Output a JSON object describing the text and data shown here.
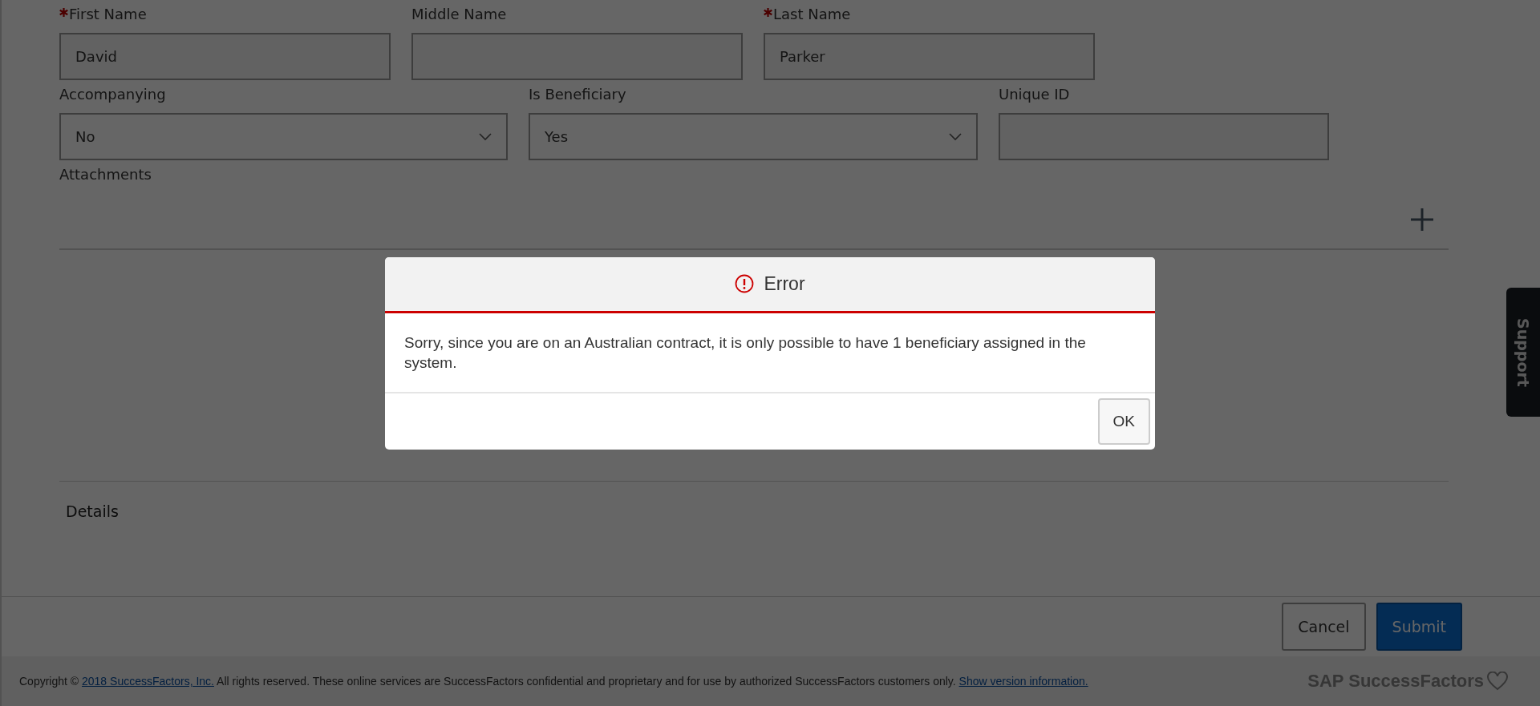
{
  "form": {
    "rows": [
      [
        {
          "label": "First Name",
          "required": true,
          "kind": "text",
          "value": "David"
        },
        {
          "label": "Middle Name",
          "required": false,
          "kind": "text"
        },
        {
          "label": "Last Name",
          "required": true,
          "kind": "text",
          "value": "Parker"
        }
      ],
      [
        {
          "label": "Accompanying",
          "required": false,
          "kind": "select",
          "value": "No"
        },
        {
          "label": "Is Beneficiary",
          "required": false,
          "kind": "select",
          "value": "Yes"
        },
        {
          "label": "Unique ID",
          "required": false,
          "kind": "text"
        }
      ]
    ],
    "attachments_label": "Attachments",
    "details_label": "Details"
  },
  "actions": [
    {
      "label": "Cancel",
      "kind": "secondary"
    },
    {
      "label": "Submit",
      "kind": "primary"
    }
  ],
  "support_tab": "Support",
  "footer": {
    "parts": [
      {
        "kind": "text",
        "text": "Copyright © "
      },
      {
        "kind": "link",
        "text": "2018 SuccessFactors, Inc."
      },
      {
        "kind": "text",
        "text": " All rights reserved. These online services are SuccessFactors confidential and proprietary and for use by authorized SuccessFactors customers only. "
      },
      {
        "kind": "link",
        "text": "Show version information."
      }
    ],
    "logo": "SAP SuccessFactors"
  },
  "dialog": {
    "title": "Error",
    "message": "Sorry, since you are on an Australian contract, it is only possible to have 1 beneficiary assigned in the system.",
    "buttons": [
      "OK"
    ]
  }
}
